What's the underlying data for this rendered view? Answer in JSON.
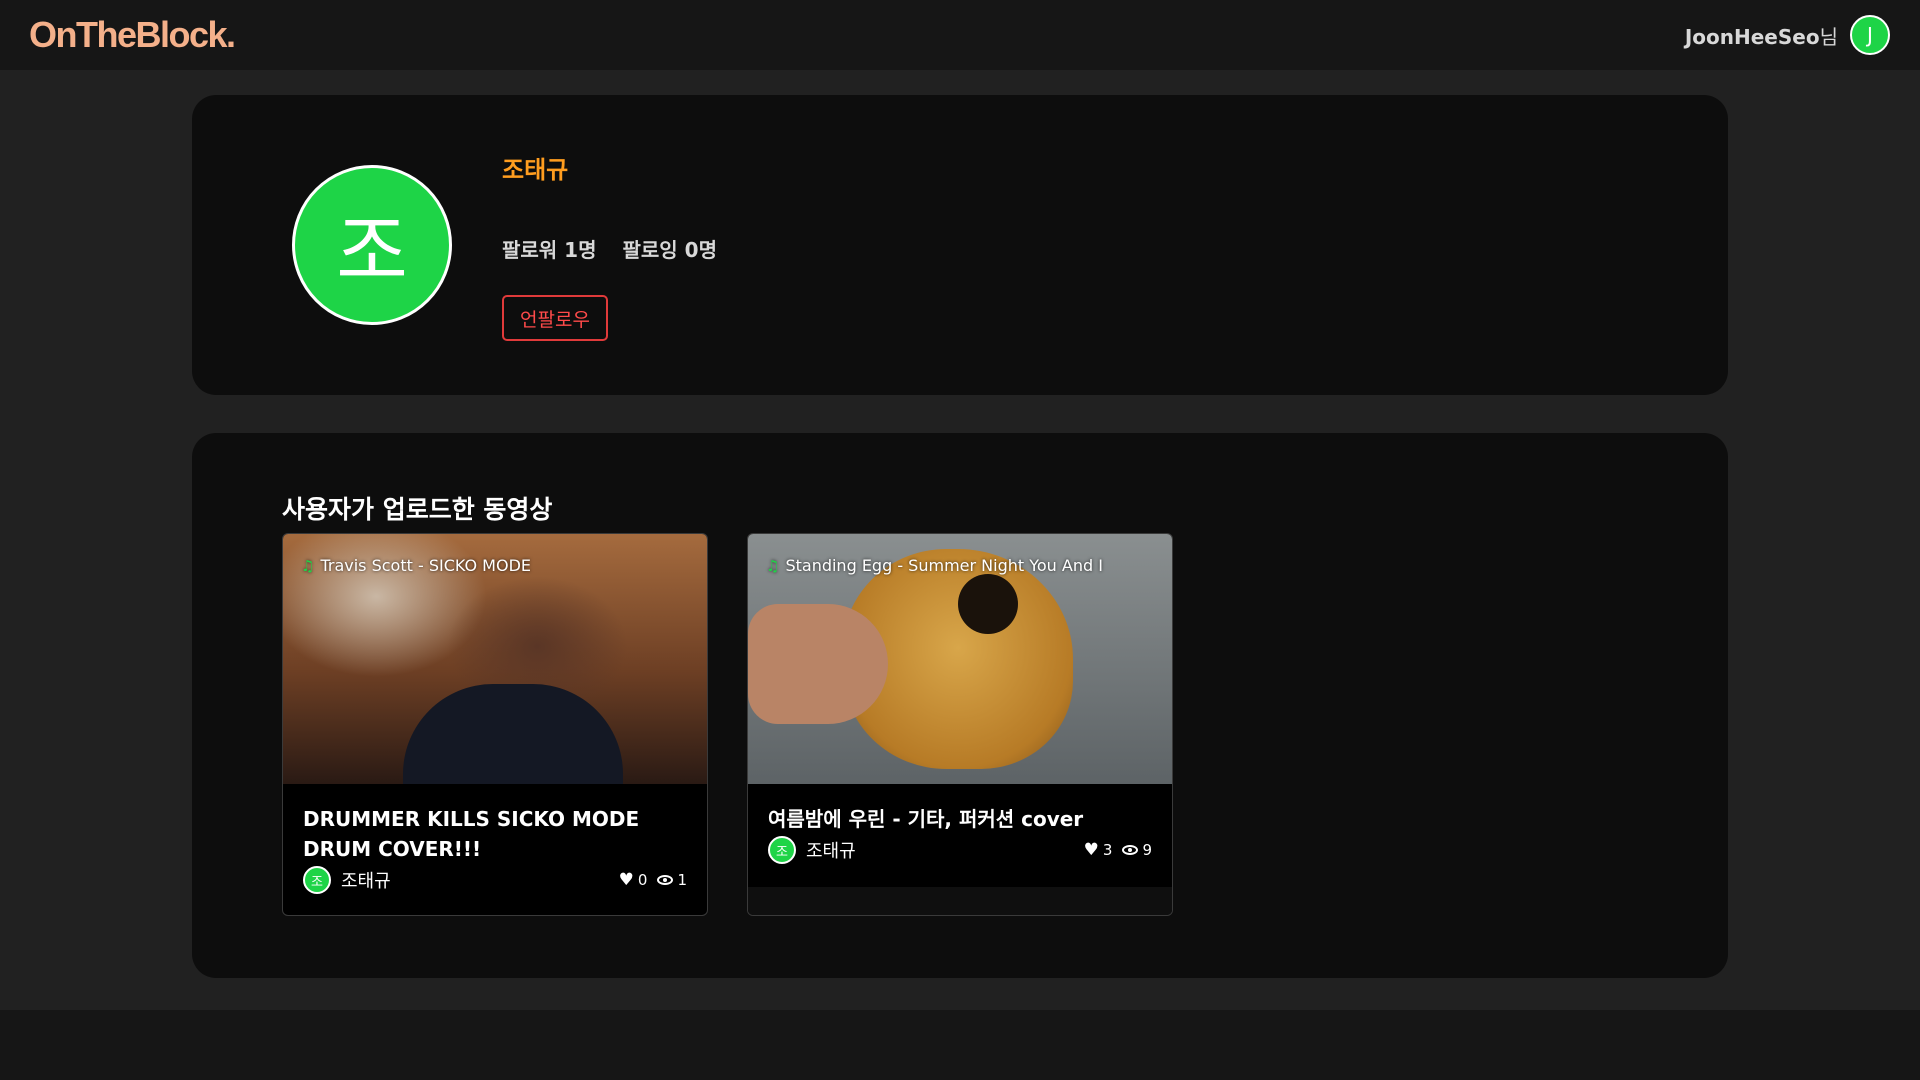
{
  "header": {
    "logo": "OnTheBlock.",
    "user_name": "JoonHeeSeo",
    "user_suffix": "님",
    "user_avatar_initial": "J"
  },
  "profile": {
    "avatar_initial": "조",
    "name": "조태규",
    "followers": "팔로워 1명",
    "following": "팔로잉 0명",
    "unfollow_label": "언팔로우"
  },
  "videos_section": {
    "title": "사용자가 업로드한 동영상",
    "videos": [
      {
        "song": "Travis Scott - SICKO MODE",
        "title": "DRUMMER KILLS SICKO MODE DRUM COVER!!!",
        "uploader_initial": "조",
        "uploader": "조태규",
        "likes": "0",
        "views": "1"
      },
      {
        "song": "Standing Egg - Summer Night You And I",
        "title": "여름밤에 우린 - 기타, 퍼커션 cover",
        "uploader_initial": "조",
        "uploader": "조태규",
        "likes": "3",
        "views": "9"
      }
    ]
  },
  "colors": {
    "accent_green": "#1ed447",
    "name_orange": "#ff9d1f",
    "unfollow_red": "#e03a3a",
    "logo_peach": "#f4b08a"
  }
}
